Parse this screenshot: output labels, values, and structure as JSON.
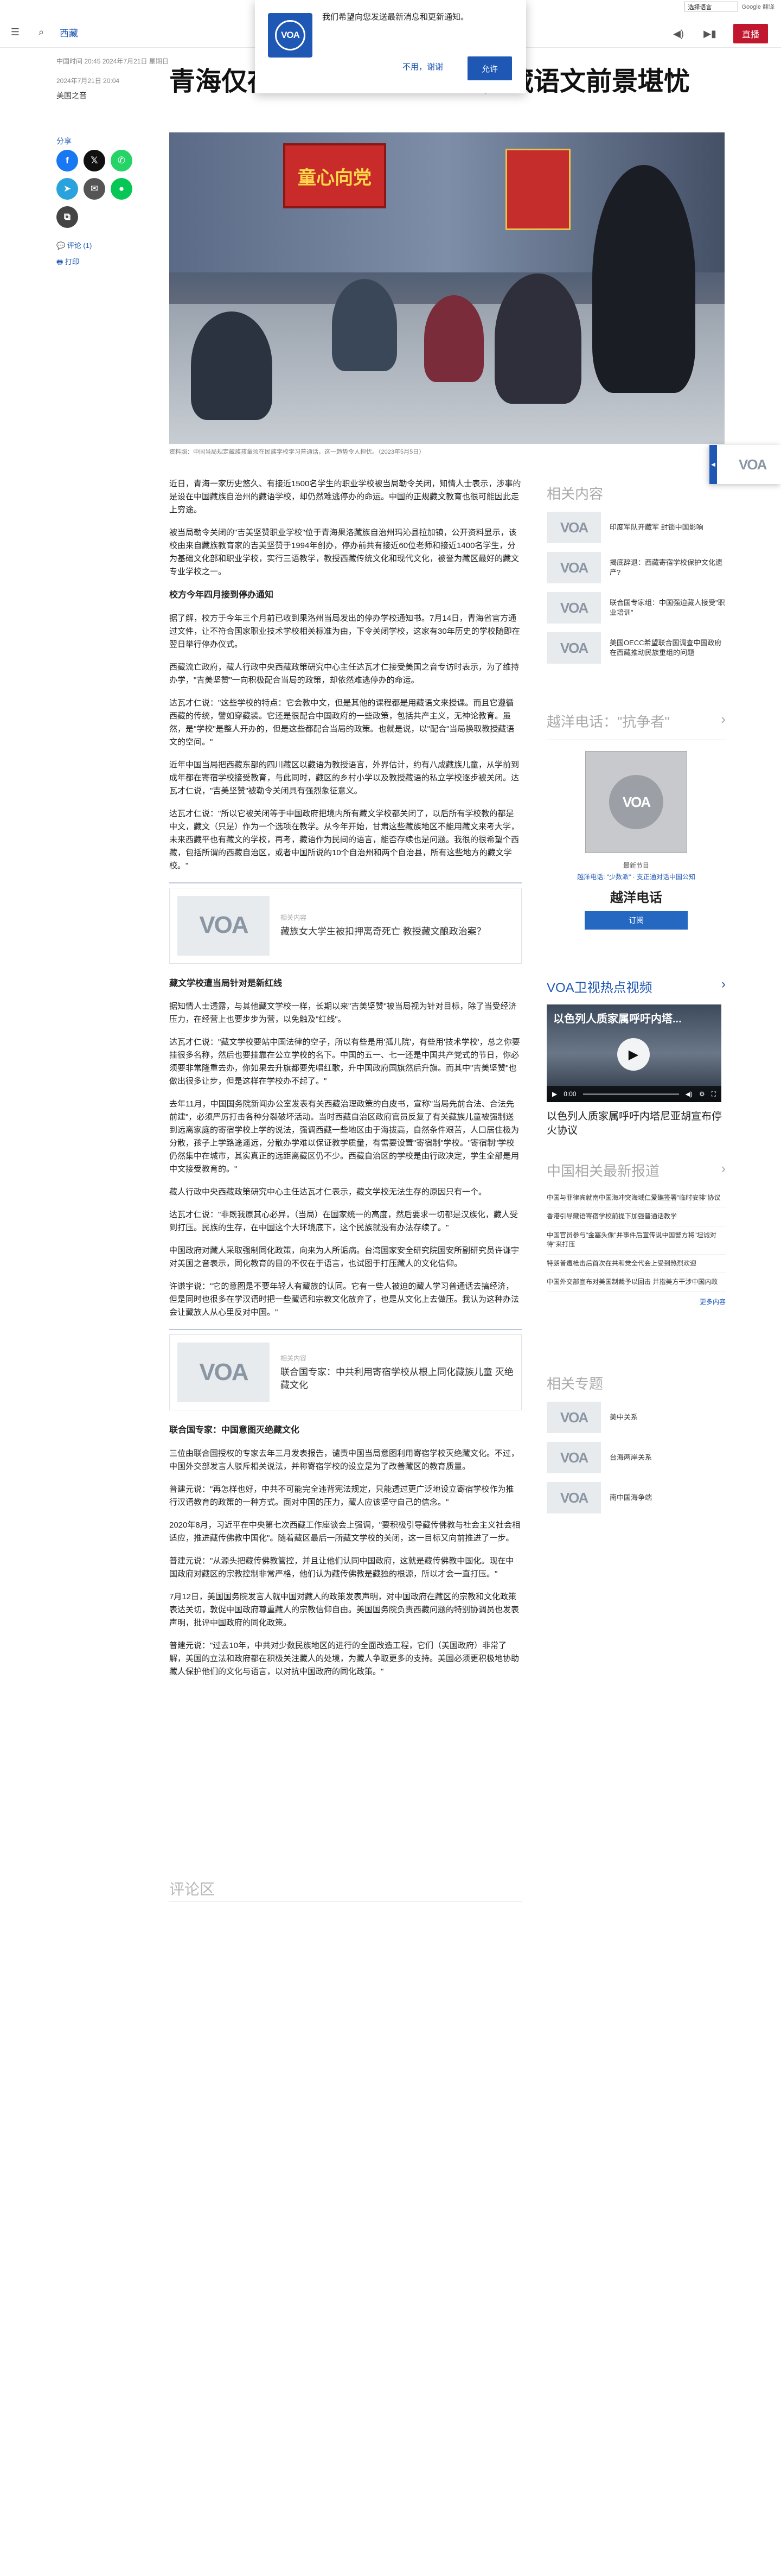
{
  "translate": {
    "select_label": "选择语言",
    "powered": "Google 翻译"
  },
  "header": {
    "section": "西藏",
    "live_label": "直播"
  },
  "popup": {
    "message": "我们希望向您发送最新消息和更新通知。",
    "no_label": "不用，谢谢",
    "yes_label": "允许",
    "logo_text": "VOA"
  },
  "article": {
    "updated": "中国时间 20:45 2024年7月21日 星期日",
    "date": "2024年7月21日 20:04",
    "author": "美国之音",
    "headline": "青海仅存藏语学校被迫转数，藏语文前景堪忧",
    "hero_banner": "童心向党",
    "caption": "资料照：中国当局规定藏族孩童须在民族学校学习普通话，这一趋势令人担忧。（2023年5月5日）",
    "p1": "近日，青海一家历史悠久、有接近1500名学生的职业学校被当局勒令关闭，知情人士表示，涉事的是设在中国藏族自治州的藏语学校，却仍然难逃停办的命运。中国的正规藏文教育也很可能因此走上穷途。",
    "p2": "被当局勒令关闭的\"吉美坚赞职业学校\"位于青海果洛藏族自治州玛沁县拉加镇，公开资料显示，该校由来自藏族教育家的吉美坚赞于1994年创办，停办前共有接近60位老师和接近1400名学生，分为基础文化部和职业学校，实行三语教学，教授西藏传统文化和现代文化，被誉为藏区最好的藏文专业学校之一。",
    "h1": "校方今年四月接到停办通知",
    "p3": "据了解，校方于今年三个月前已收到果洛州当局发出的停办学校通知书。7月14日，青海省官方通过文件，让不符合国家职业技术学校相关标准为由，下令关闭学校，这家有30年历史的学校随即在翌日举行停办仪式。",
    "p4": "西藏流亡政府，藏人行政中央西藏政策研究中心主任达瓦才仁接受美国之音专访时表示，为了维持办学，\"吉美坚赞\"一向积极配合当局的政策，却依然难逃停办的命运。",
    "p5": "达瓦才仁说：\"这些学校的特点：它会教中文，但是其他的课程都是用藏语文来授课。而且它遵循西藏的传统，譬如穿藏装。它还是很配合中国政府的一些政策，包括共产主义，无神论教育。虽然，是\"学校\"是整人开办的，但是这些都配合当局的政策。也就是说，以\"配合\"当局换取教授藏语文的空间。\"",
    "p6": "近年中国当局把西藏东部的四川藏区以藏语为教授语言，外界估计，约有八成藏族儿童，从学前到成年都在寄宿学校接受教育，与此同时，藏区的乡村小学以及教授藏语的私立学校逐步被关闭。达瓦才仁说，\"吉美坚赞\"被勒令关闭具有强烈象征意义。",
    "p7": "达瓦才仁说：\"所以它被关闭等于中国政府把境内所有藏文学校都关闭了，以后所有学校教的都是中文，藏文（只是）作为一个选项在教学。从今年开始，甘肃这些藏族地区不能用藏文来考大学，未来西藏平也有藏文的学校，再考，藏语作为民间的语言，能否存续也是问题。我很的很希望个西藏，包括所谓的西藏自治区，或者中国所说的10个自治州和两个自治县，所有这些地方的藏文学校。\"",
    "card1_kicker": "相关内容",
    "card1_title": "藏族女大学生被扣押离奇死亡 教授藏文酿政治案？",
    "h2": "藏文学校遭当局针对是新红线",
    "p8": "据知情人士透露，与其他藏文学校一样，长期以来\"吉美坚赞\"被当局视为针对目标，除了当受经济压力，在经营上也要步步为营，以免触及\"红线\"。",
    "p9": "达瓦才仁说：\"藏文学校要站中国法律的空子，所以有些是用'孤儿院'，有些用'技术学校'，总之你要挂很多名称，然后也要挂靠在公立学校的名下。中国的五一、七一还是中国共产党式的节日，你必须要非常隆重去办，你如果去升旗都要先唱红歌，升中国政府国旗然后升旗。而其中\"吉美坚赞\"也做出很多让步，但是这样在学校办不起了。\"",
    "p10": "去年11月，中国国务院新闻办公室发表有关西藏治理政策的白皮书，宣称\"当局先前合法、合法先前建\"，必须严厉打击各种分裂破坏活动。当时西藏自治区政府官员反复了有关藏族儿童被强制送到远离家庭的寄宿学校上学的说法，强调西藏一些地区由于海拔高，自然条件艰苦，人口居住极为分散，孩子上学路途遥远，分散办学难以保证教学质量，有需要设置\"寄宿制\"学校。\"寄宿制\"学校仍然集中在城市，其实真正的远距离藏区仍不少。西藏自治区的学校是由行政决定，学生全部是用中文接受教育的。\"",
    "p11": "藏人行政中央西藏政策研究中心主任达瓦才仁表示，藏文学校无法生存的原因只有一个。",
    "p12": "达瓦才仁说：\"非既我原其心必异，（当局）在国家统一的高度，然后要求一切都是汉族化，藏人受到打压。民族的生存，在中国这个大环境底下，这个民族就没有办法存续了。\"",
    "p13": "中国政府对藏人采取强制同化政策，向来为人所诟病。台湾国家安全研究院国安所副研究员许谦宇对美国之音表示，同化教育的目的不仅在于语言，也试图于打压藏人的文化信仰。",
    "p14": "许谦宇说：\"它的意图是不要年轻人有藏族的认同。它有一些人被迫的藏人学习普通话去搞经济，但是同时也很多在学汉语时把一些藏语和宗教文化放弃了，也是从文化上去做压。我认为这种办法会让藏族人从心里反对中国。\"",
    "card2_kicker": "相关内容",
    "card2_title": "联合国专家：中共利用寄宿学校从根上同化藏族儿童 灭绝藏文化",
    "h3": "联合国专家：中国意图灭绝藏文化",
    "p15": "三位由联合国授权的专家去年三月发表报告，谴责中国当局意图利用寄宿学校灭绝藏文化。不过，中国外交部发言人驳斥相关说法，并称寄宿学校的设立是为了改善藏区的教育质量。",
    "p16": "普建元说：\"再怎样也好，中共不可能完全违背宪法规定，只能透过更广泛地设立寄宿学校作为推行汉语教育的政策的一种方式。面对中国的压力，藏人应该坚守自己的信念。\"",
    "p17": "2020年8月，习近平在中央第七次西藏工作座谈会上强调，\"要积极引导藏传佛教与社会主义社会相适应，推进藏传佛教中国化\"。随着藏区最后一所藏文学校的关闭，这一目标又向前推进了一步。",
    "p18": "普建元说：\"从源头把藏传佛教管控，并且让他们认同中国政府，这就是藏传佛教中国化。现在中国政府对藏区的宗教控制非常严格，他们认为藏传佛教是藏独的根源，所以才会一直打压。\"",
    "p19": "7月12日，美国国务院发言人就中国对藏人的政策发表声明，对中国政府在藏区的宗教和文化政策表达关切，敦促中国政府尊重藏人的宗教信仰自由。美国国务院负责西藏问题的特别协调员也发表声明，批评中国政府的同化政策。",
    "p20": "普建元说：\"过去10年，中共对少数民族地区的进行的全面改造工程，它们（美国政府）非常了解，美国的立法和政府都在积极关注藏人的处境，为藏人争取更多的支持。美国必须更积极地协助藏人保护他们的文化与语言，以对抗中国政府的同化政策。\"",
    "comments_heading": "评论区"
  },
  "share": {
    "label": "分享",
    "comments": "评论 (1)",
    "print": "打印"
  },
  "sidebar": {
    "related_title": "相关内容",
    "related": [
      {
        "text": "印度军队开藏军 封锁中国影响"
      },
      {
        "text": "揭底辞退：西藏寄宿学校保护文化遗产?"
      },
      {
        "text": "联合国专家组：中国强迫藏人接受\"职业培训\""
      },
      {
        "text": "美国OECC希望联合国调查中国政府在西藏推动民族重组的问题"
      }
    ],
    "podcast_title": "越洋电话：\"抗争者\"",
    "podcast_kicker": "最新节目",
    "podcast_links": "越洋电话: \"少数派\" · 支正通对话中国公知",
    "podcast_name": "越洋电话",
    "subscribe": "订阅",
    "video_title": "VOA卫视热点视频",
    "video_overlay": "以色列人质家属呼吁内塔...",
    "video_time": "0:00",
    "video_caption": "以色列人质家属呼吁内塔尼亚胡宣布停火协议",
    "news_title": "中国相关最新报道",
    "news": [
      "中国与菲律宾就南中国海冲突海域仁爱礁签署\"临时安排\"协议",
      "香港引导藏语寄宿学校前提下加强普通话教学",
      "中国官员参与\"金塞头像\"并事件后宣传说中国警方将\"坦诚对待\"来打压",
      "特朗普遭枪击后首次在共和党全代会上受到热烈欢迎",
      "中国外交部宣布对美国制裁予以回击 并指美方干涉中国内政"
    ],
    "more": "更多内容",
    "topics_title": "相关专题",
    "topics": [
      {
        "text": "美中关系"
      },
      {
        "text": "台海两岸关系"
      },
      {
        "text": "南中国海争端"
      }
    ]
  },
  "brand": {
    "primary": "#1f57b5",
    "live": "#c0162e"
  }
}
